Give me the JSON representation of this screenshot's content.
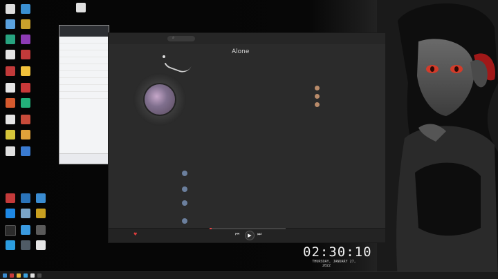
{
  "window_title": "",
  "player": {
    "song_title": "Alone",
    "song_sub1": "",
    "song_sub2": "",
    "search_icon": "search-icon",
    "lyrics": [
      {
        "text": "",
        "active": false
      },
      {
        "text": "",
        "active": false
      },
      {
        "text": "",
        "active": false
      },
      {
        "text": "",
        "active": false
      },
      {
        "text": "",
        "active": true
      },
      {
        "text": "",
        "active": false
      },
      {
        "text": "",
        "active": false
      },
      {
        "text": "",
        "active": false
      },
      {
        "text": "",
        "active": false
      }
    ],
    "comments_title": "",
    "comments": [
      {
        "user": "",
        "text": "",
        "time": "",
        "likes": ""
      },
      {
        "user": "",
        "text": "",
        "time": "",
        "likes": ""
      },
      {
        "user": "",
        "text": "",
        "time": "",
        "likes": ""
      },
      {
        "user": "",
        "text": "",
        "time": "",
        "likes": ""
      }
    ],
    "side_head": "",
    "side_items": [
      "",
      "",
      ""
    ],
    "controls": {
      "prev": "⏮",
      "play": "▶",
      "next": "⏭",
      "like": "♥"
    },
    "progress": 0.03
  },
  "clock": {
    "time": "02:30:10",
    "date": "THURSDAY, JANUARY 27,",
    "year": "2022"
  },
  "taskbar": {
    "tray_time": ""
  },
  "colors": {
    "accent": "#e44444",
    "panel": "#2b2b2b"
  }
}
